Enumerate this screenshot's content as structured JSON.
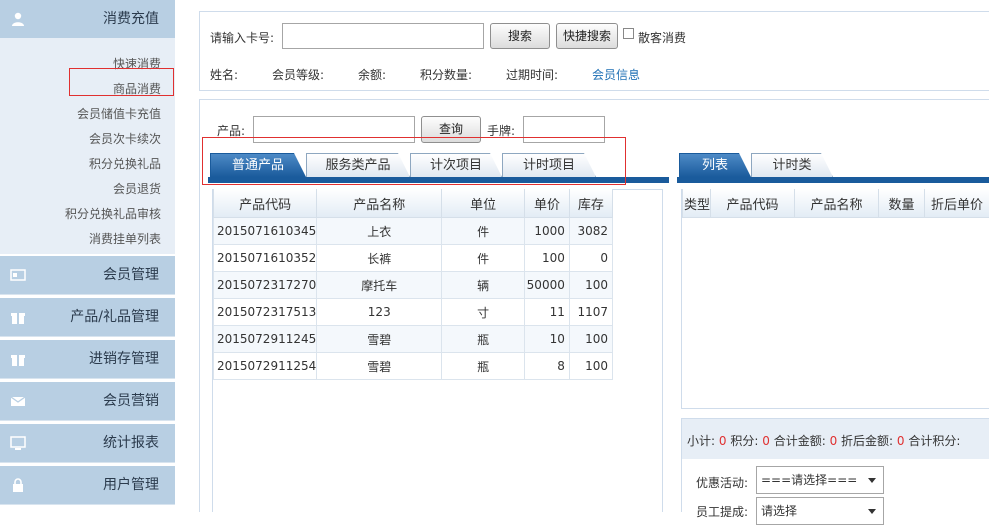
{
  "sidebar": {
    "active_section": "消费充值",
    "sub_items": [
      "快速消费",
      "商品消费",
      "会员储值卡充值",
      "会员次卡续次",
      "积分兑换礼品",
      "会员退货",
      "积分兑换礼品审核",
      "消费挂单列表"
    ],
    "sections": [
      "会员管理",
      "产品/礼品管理",
      "进销存管理",
      "会员营销",
      "统计报表",
      "用户管理"
    ]
  },
  "search": {
    "card_label": "请输入卡号:",
    "card_value": "",
    "search_button": "搜索",
    "quick_search_button": "快捷搜索",
    "walkin_label": "散客消费",
    "walkin_checked": false
  },
  "member_info": {
    "name_label": "姓名:",
    "level_label": "会员等级:",
    "balance_label": "余额:",
    "points_label": "积分数量:",
    "expiry_label": "过期时间:",
    "info_link": "会员信息"
  },
  "product_filter": {
    "product_label": "产品:",
    "product_value": "",
    "query_button": "查询",
    "tag_label": "手牌:",
    "tag_value": ""
  },
  "product_tabs": [
    "普通产品",
    "服务类产品",
    "计次项目",
    "计时项目"
  ],
  "product_table": {
    "columns": [
      "产品代码",
      "产品名称",
      "单位",
      "单价",
      "库存"
    ],
    "rows": [
      [
        "2015071610345",
        "上衣",
        "件",
        "1000",
        "3082"
      ],
      [
        "2015071610352",
        "长裤",
        "件",
        "100",
        "0"
      ],
      [
        "2015072317270",
        "摩托车",
        "辆",
        "50000",
        "100"
      ],
      [
        "2015072317513",
        "123",
        "寸",
        "11",
        "1107"
      ],
      [
        "2015072911245",
        "雪碧",
        "瓶",
        "10",
        "100"
      ],
      [
        "2015072911254",
        "雪碧",
        "瓶",
        "8",
        "100"
      ]
    ]
  },
  "cart_tabs": [
    "列表",
    "计时类"
  ],
  "cart_table": {
    "columns": [
      "类型",
      "产品代码",
      "产品名称",
      "数量",
      "折后单价"
    ]
  },
  "summary": {
    "subtotal_label": "小计:",
    "subtotal_value": "0",
    "points_label": "积分:",
    "points_value": "0",
    "total_label": "合计金额:",
    "total_value": "0",
    "discount_total_label": "折后金额:",
    "discount_total_value": "0",
    "total_points_label": "合计积分:"
  },
  "options": {
    "promo_label": "优惠活动:",
    "promo_value": "===请选择===",
    "staff_label": "员工提成:",
    "staff_value": "请选择"
  },
  "colors": {
    "sidebar_header": "#b8cfe3",
    "sidebar_sub_bg": "#e7eef6",
    "tab_active": "#1a5b9c",
    "highlight_border": "#e03030",
    "link": "#1e6fb4"
  }
}
